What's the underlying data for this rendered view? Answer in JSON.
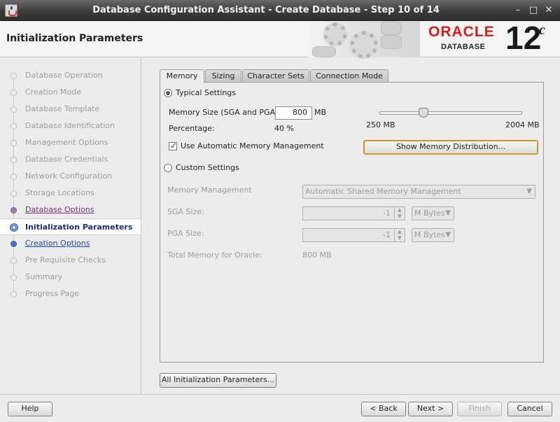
{
  "window": {
    "title": "Database Configuration Assistant - Create Database - Step 10 of 14",
    "minimize_icon": "minimize-icon",
    "maximize_icon": "maximize-icon",
    "close_icon": "close-icon"
  },
  "header": {
    "page_title": "Initialization Parameters",
    "brand_word": "ORACLE",
    "brand_sub": "DATABASE",
    "brand_version": "12",
    "brand_suffix": "c",
    "brand_color": "#d31f1f"
  },
  "nav": {
    "items": [
      {
        "label": "Database Operation",
        "state": "done"
      },
      {
        "label": "Creation Mode",
        "state": "done"
      },
      {
        "label": "Database Template",
        "state": "done"
      },
      {
        "label": "Database Identification",
        "state": "done"
      },
      {
        "label": "Management Options",
        "state": "done"
      },
      {
        "label": "Database Credentials",
        "state": "done"
      },
      {
        "label": "Network Configuration",
        "state": "done"
      },
      {
        "label": "Storage Locations",
        "state": "done"
      },
      {
        "label": "Database Options",
        "state": "visited"
      },
      {
        "label": "Initialization Parameters",
        "state": "current"
      },
      {
        "label": "Creation Options",
        "state": "link"
      },
      {
        "label": "Pre Requisite Checks",
        "state": "pending"
      },
      {
        "label": "Summary",
        "state": "pending"
      },
      {
        "label": "Progress Page",
        "state": "pending"
      }
    ]
  },
  "tabs": [
    {
      "label": "Memory",
      "active": true
    },
    {
      "label": "Sizing",
      "active": false
    },
    {
      "label": "Character Sets",
      "active": false
    },
    {
      "label": "Connection Mode",
      "active": false
    }
  ],
  "memory": {
    "typical_label": "Typical Settings",
    "typical_selected": true,
    "memory_size_label": "Memory Size (SGA and PGA):",
    "memory_size_value": "800",
    "memory_size_unit": "MB",
    "percentage_label": "Percentage:",
    "percentage_value": "40 %",
    "slider_min": "250 MB",
    "slider_max": "2004 MB",
    "slider_value_mb": 800,
    "use_amm_label": "Use Automatic Memory Management",
    "use_amm_checked": true,
    "show_distribution_label": "Show Memory Distribution...",
    "custom_label": "Custom Settings",
    "custom_selected": false,
    "memory_management_label": "Memory Management",
    "memory_management_value": "Automatic Shared Memory Management",
    "sga_label": "SGA Size:",
    "sga_value": "-1",
    "sga_unit": "M Bytes",
    "pga_label": "PGA Size:",
    "pga_value": "-1",
    "pga_unit": "M Bytes",
    "total_label": "Total Memory for Oracle:",
    "total_value": "800 MB"
  },
  "buttons": {
    "all_params": "All Initialization Parameters...",
    "help": "Help",
    "back": "< Back",
    "next": "Next >",
    "finish": "Finish",
    "cancel": "Cancel"
  }
}
